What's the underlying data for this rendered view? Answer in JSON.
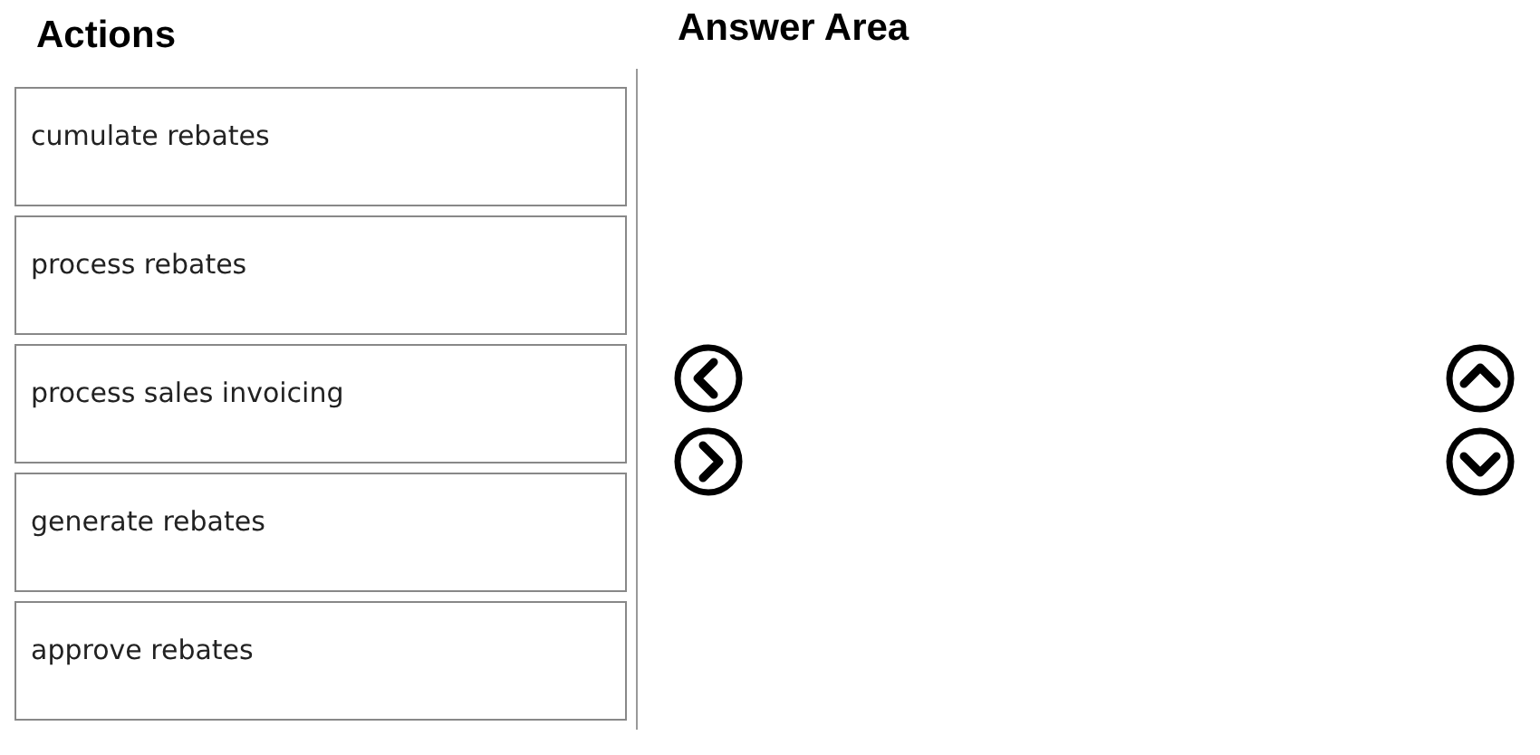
{
  "actions": {
    "title": "Actions",
    "items": [
      {
        "label": "cumulate rebates"
      },
      {
        "label": "process rebates"
      },
      {
        "label": "process sales invoicing"
      },
      {
        "label": "generate rebates"
      },
      {
        "label": "approve rebates"
      }
    ]
  },
  "answer_area": {
    "title": "Answer Area"
  }
}
